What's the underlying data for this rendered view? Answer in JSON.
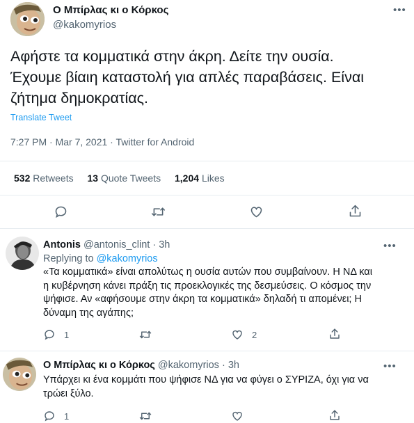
{
  "main_tweet": {
    "author_name": "Ο Μπίρλας κι ο Κόρκος",
    "author_handle": "@kakomyrios",
    "text_lines": [
      "Αφήστε τα κομματικά στην άκρη. Δείτε την ουσία.",
      "Έχουμε βίαιη καταστολή για απλές παραβάσεις. Είναι",
      "ζήτημα δημοκρατίας."
    ],
    "translate_label": "Translate Tweet",
    "timestamp": "7:27 PM · Mar 7, 2021 · Twitter for Android",
    "stats": {
      "retweets_count": "532",
      "retweets_label": "Retweets",
      "quotes_count": "13",
      "quotes_label": "Quote Tweets",
      "likes_count": "1,204",
      "likes_label": "Likes"
    }
  },
  "replies": [
    {
      "author_name": "Antonis",
      "author_handle": "@antonis_clint",
      "time": "· 3h",
      "replying_prefix": "Replying to",
      "replying_handle": "@kakomyrios",
      "text_lines": [
        "«Τα κομματικά» είναι απολύτως η ουσία αυτών που συμβαίνουν. Η ΝΔ και",
        "η κυβέρνηση κάνει πράξη τις προεκλογικές της δεσμεύσεις. Ο κόσμος την",
        "ψήφισε. Αν «αφήσουμε στην άκρη τα κομματικά» δηλαδή τι απομένει; Η",
        "δύναμη της αγάπης;"
      ],
      "reply_count": "1",
      "like_count": "2"
    },
    {
      "author_name": "Ο Μπίρλας κι ο Κόρκος",
      "author_handle": "@kakomyrios",
      "time": "· 3h",
      "text_lines": [
        "Υπάρχει κι ένα κομμάτι που ψήφισε ΝΔ για να φύγει ο ΣΥΡΙΖΑ, όχι για να",
        "τρώει ξύλο."
      ],
      "reply_count": "1"
    }
  ],
  "more_icon": "•••",
  "colors": {
    "link": "#1d9bf0",
    "muted": "#536471",
    "divider": "#e6ecf0"
  }
}
